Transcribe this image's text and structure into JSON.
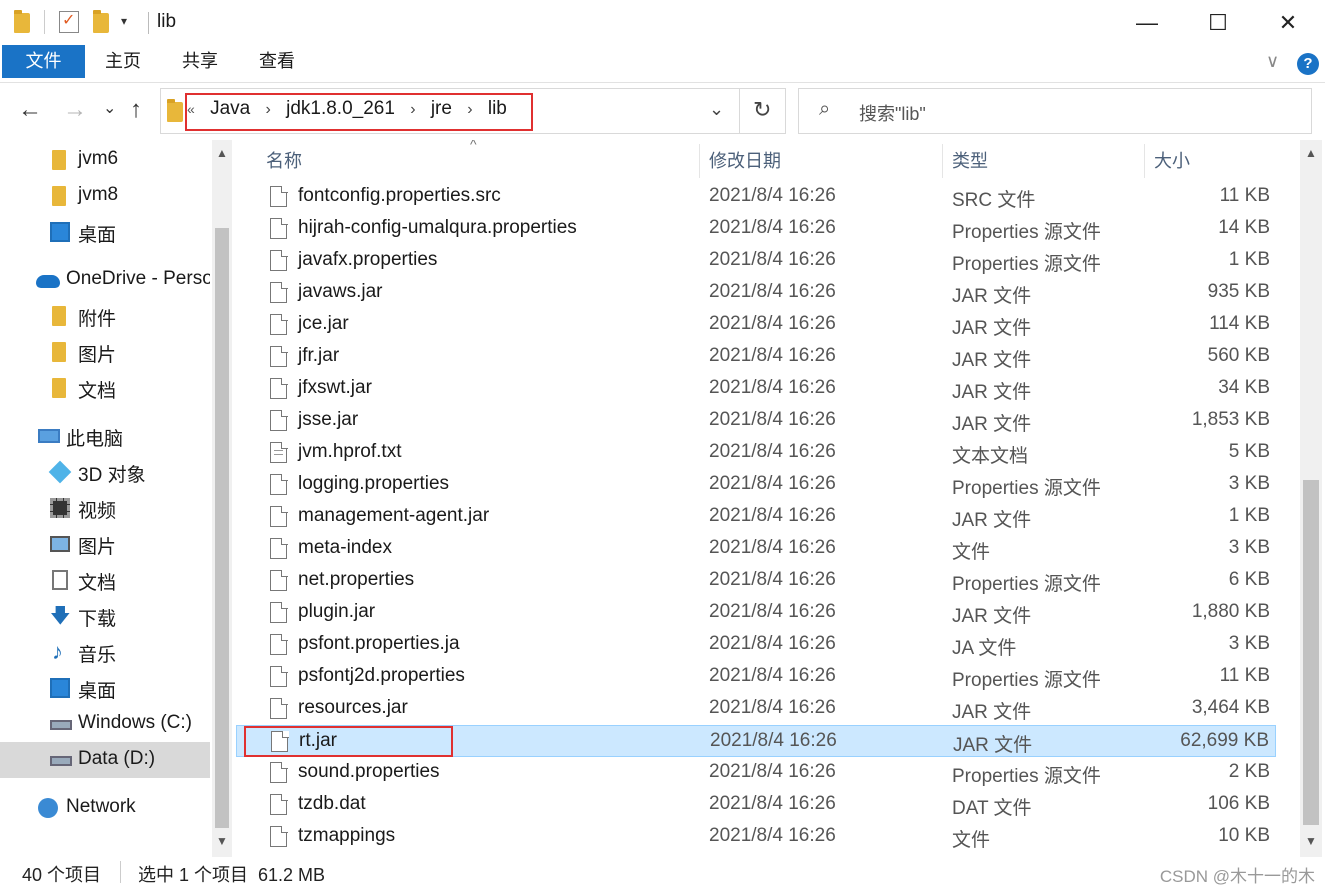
{
  "window": {
    "title": "lib",
    "minimize": "—",
    "maximize": "☐",
    "close": "✕"
  },
  "ribbon": {
    "tabs": [
      "文件",
      "主页",
      "共享",
      "查看"
    ],
    "expand": "∨",
    "help": "?"
  },
  "address": {
    "prefix": "«",
    "crumbs": [
      "Java",
      "jdk1.8.0_261",
      "jre",
      "lib"
    ],
    "separator": "›",
    "dropdown": "⌄",
    "refresh": "↻"
  },
  "search": {
    "icon": "⌕",
    "placeholder": "搜索\"lib\""
  },
  "nav": {
    "back": "←",
    "forward": "→",
    "recent": "⌄",
    "up": "↑"
  },
  "sidebar": {
    "items": [
      {
        "label": "jvm6",
        "icon": "folder-icon"
      },
      {
        "label": "jvm8",
        "icon": "folder-icon"
      },
      {
        "label": "桌面",
        "icon": "desktop-icon"
      },
      {
        "label": "OneDrive - Perso",
        "icon": "onedrive-icon"
      },
      {
        "label": "附件",
        "icon": "folder-icon"
      },
      {
        "label": "图片",
        "icon": "folder-icon"
      },
      {
        "label": "文档",
        "icon": "folder-icon"
      },
      {
        "label": "此电脑",
        "icon": "this-pc-icon"
      },
      {
        "label": "3D 对象",
        "icon": "3d-objects-icon"
      },
      {
        "label": "视频",
        "icon": "video-icon"
      },
      {
        "label": "图片",
        "icon": "pictures-icon"
      },
      {
        "label": "文档",
        "icon": "documents-icon"
      },
      {
        "label": "下载",
        "icon": "download-icon"
      },
      {
        "label": "音乐",
        "icon": "music-icon"
      },
      {
        "label": "桌面",
        "icon": "desktop-icon"
      },
      {
        "label": "Windows (C:)",
        "icon": "drive-icon"
      },
      {
        "label": "Data (D:)",
        "icon": "drive-icon"
      },
      {
        "label": "Network",
        "icon": "network-icon"
      }
    ]
  },
  "columns": {
    "name": "名称",
    "date": "修改日期",
    "type": "类型",
    "size": "大小",
    "sort_indicator": "^"
  },
  "files": [
    {
      "name": "fontconfig.properties.src",
      "date": "2021/8/4 16:26",
      "type": "SRC 文件",
      "size": "11 KB"
    },
    {
      "name": "hijrah-config-umalqura.properties",
      "date": "2021/8/4 16:26",
      "type": "Properties 源文件",
      "size": "14 KB"
    },
    {
      "name": "javafx.properties",
      "date": "2021/8/4 16:26",
      "type": "Properties 源文件",
      "size": "1 KB"
    },
    {
      "name": "javaws.jar",
      "date": "2021/8/4 16:26",
      "type": "JAR 文件",
      "size": "935 KB"
    },
    {
      "name": "jce.jar",
      "date": "2021/8/4 16:26",
      "type": "JAR 文件",
      "size": "114 KB"
    },
    {
      "name": "jfr.jar",
      "date": "2021/8/4 16:26",
      "type": "JAR 文件",
      "size": "560 KB"
    },
    {
      "name": "jfxswt.jar",
      "date": "2021/8/4 16:26",
      "type": "JAR 文件",
      "size": "34 KB"
    },
    {
      "name": "jsse.jar",
      "date": "2021/8/4 16:26",
      "type": "JAR 文件",
      "size": "1,853 KB"
    },
    {
      "name": "jvm.hprof.txt",
      "date": "2021/8/4 16:26",
      "type": "文本文档",
      "size": "5 KB"
    },
    {
      "name": "logging.properties",
      "date": "2021/8/4 16:26",
      "type": "Properties 源文件",
      "size": "3 KB"
    },
    {
      "name": "management-agent.jar",
      "date": "2021/8/4 16:26",
      "type": "JAR 文件",
      "size": "1 KB"
    },
    {
      "name": "meta-index",
      "date": "2021/8/4 16:26",
      "type": "文件",
      "size": "3 KB"
    },
    {
      "name": "net.properties",
      "date": "2021/8/4 16:26",
      "type": "Properties 源文件",
      "size": "6 KB"
    },
    {
      "name": "plugin.jar",
      "date": "2021/8/4 16:26",
      "type": "JAR 文件",
      "size": "1,880 KB"
    },
    {
      "name": "psfont.properties.ja",
      "date": "2021/8/4 16:26",
      "type": "JA 文件",
      "size": "3 KB"
    },
    {
      "name": "psfontj2d.properties",
      "date": "2021/8/4 16:26",
      "type": "Properties 源文件",
      "size": "11 KB"
    },
    {
      "name": "resources.jar",
      "date": "2021/8/4 16:26",
      "type": "JAR 文件",
      "size": "3,464 KB"
    },
    {
      "name": "rt.jar",
      "date": "2021/8/4 16:26",
      "type": "JAR 文件",
      "size": "62,699 KB",
      "selected": true
    },
    {
      "name": "sound.properties",
      "date": "2021/8/4 16:26",
      "type": "Properties 源文件",
      "size": "2 KB"
    },
    {
      "name": "tzdb.dat",
      "date": "2021/8/4 16:26",
      "type": "DAT 文件",
      "size": "106 KB"
    },
    {
      "name": "tzmappings",
      "date": "2021/8/4 16:26",
      "type": "文件",
      "size": "10 KB"
    }
  ],
  "status": {
    "count": "40 个项目",
    "selection": "选中 1 个项目  61.2 MB",
    "watermark": "CSDN @木十一的木"
  },
  "colors": {
    "accent": "#1a73c6",
    "selection_bg": "#cce8ff",
    "highlight_box": "#e03030"
  }
}
